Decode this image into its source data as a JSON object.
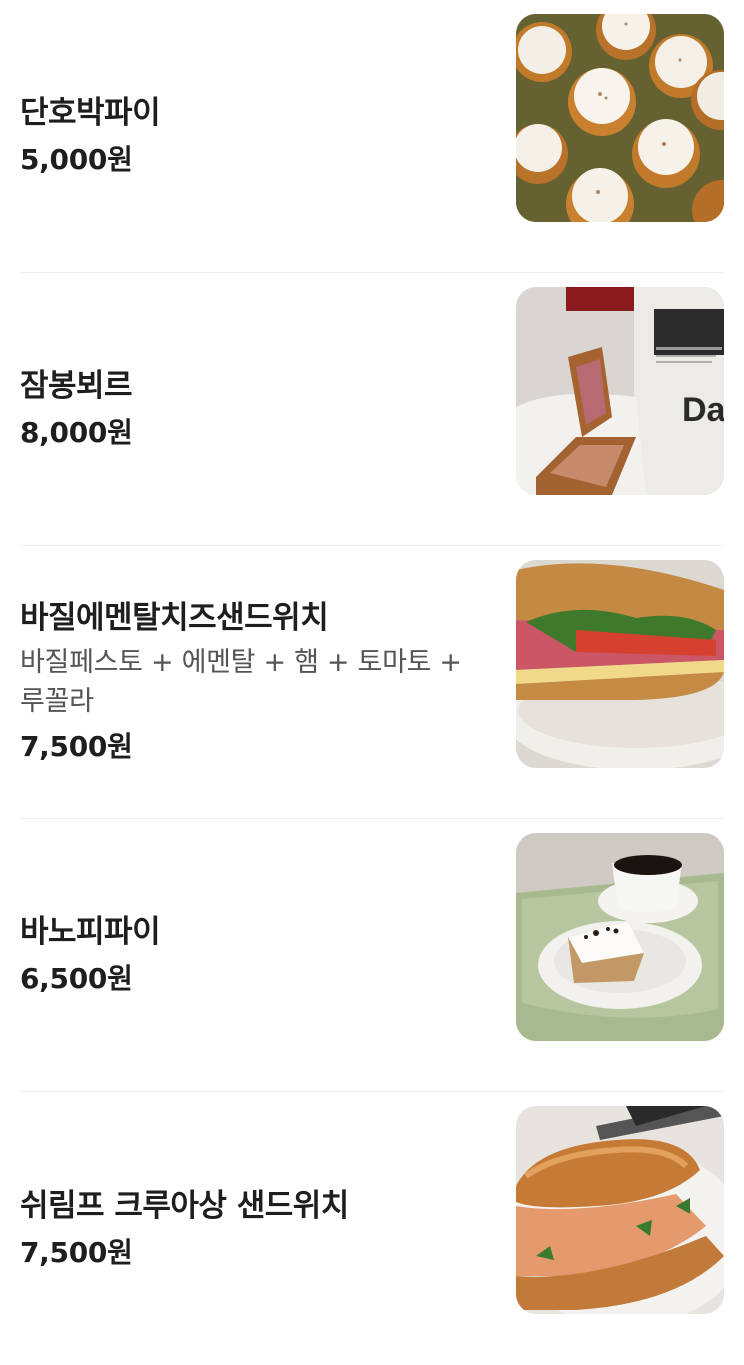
{
  "menu": {
    "items": [
      {
        "name": "단호박파이",
        "description": "",
        "price": "5,000원",
        "image": "pumpkin-pie-photo"
      },
      {
        "name": "잠봉뵈르",
        "description": "",
        "price": "8,000원",
        "image": "jambon-beurre-photo",
        "image_text": "Da"
      },
      {
        "name": "바질에멘탈치즈샌드위치",
        "description": "바질페스토 + 에멘탈 + 햄 + 토마토 + 루꼴라",
        "price": "7,500원",
        "image": "basil-sandwich-photo"
      },
      {
        "name": "바노피파이",
        "description": "",
        "price": "6,500원",
        "image": "banoffee-pie-photo"
      },
      {
        "name": "쉬림프 크루아상 샌드위치",
        "description": "",
        "price": "7,500원",
        "image": "shrimp-croissant-photo"
      }
    ]
  },
  "colors": {
    "text": "#1e1e1e",
    "description": "#555555",
    "divider": "#eeeeee",
    "background": "#ffffff"
  }
}
